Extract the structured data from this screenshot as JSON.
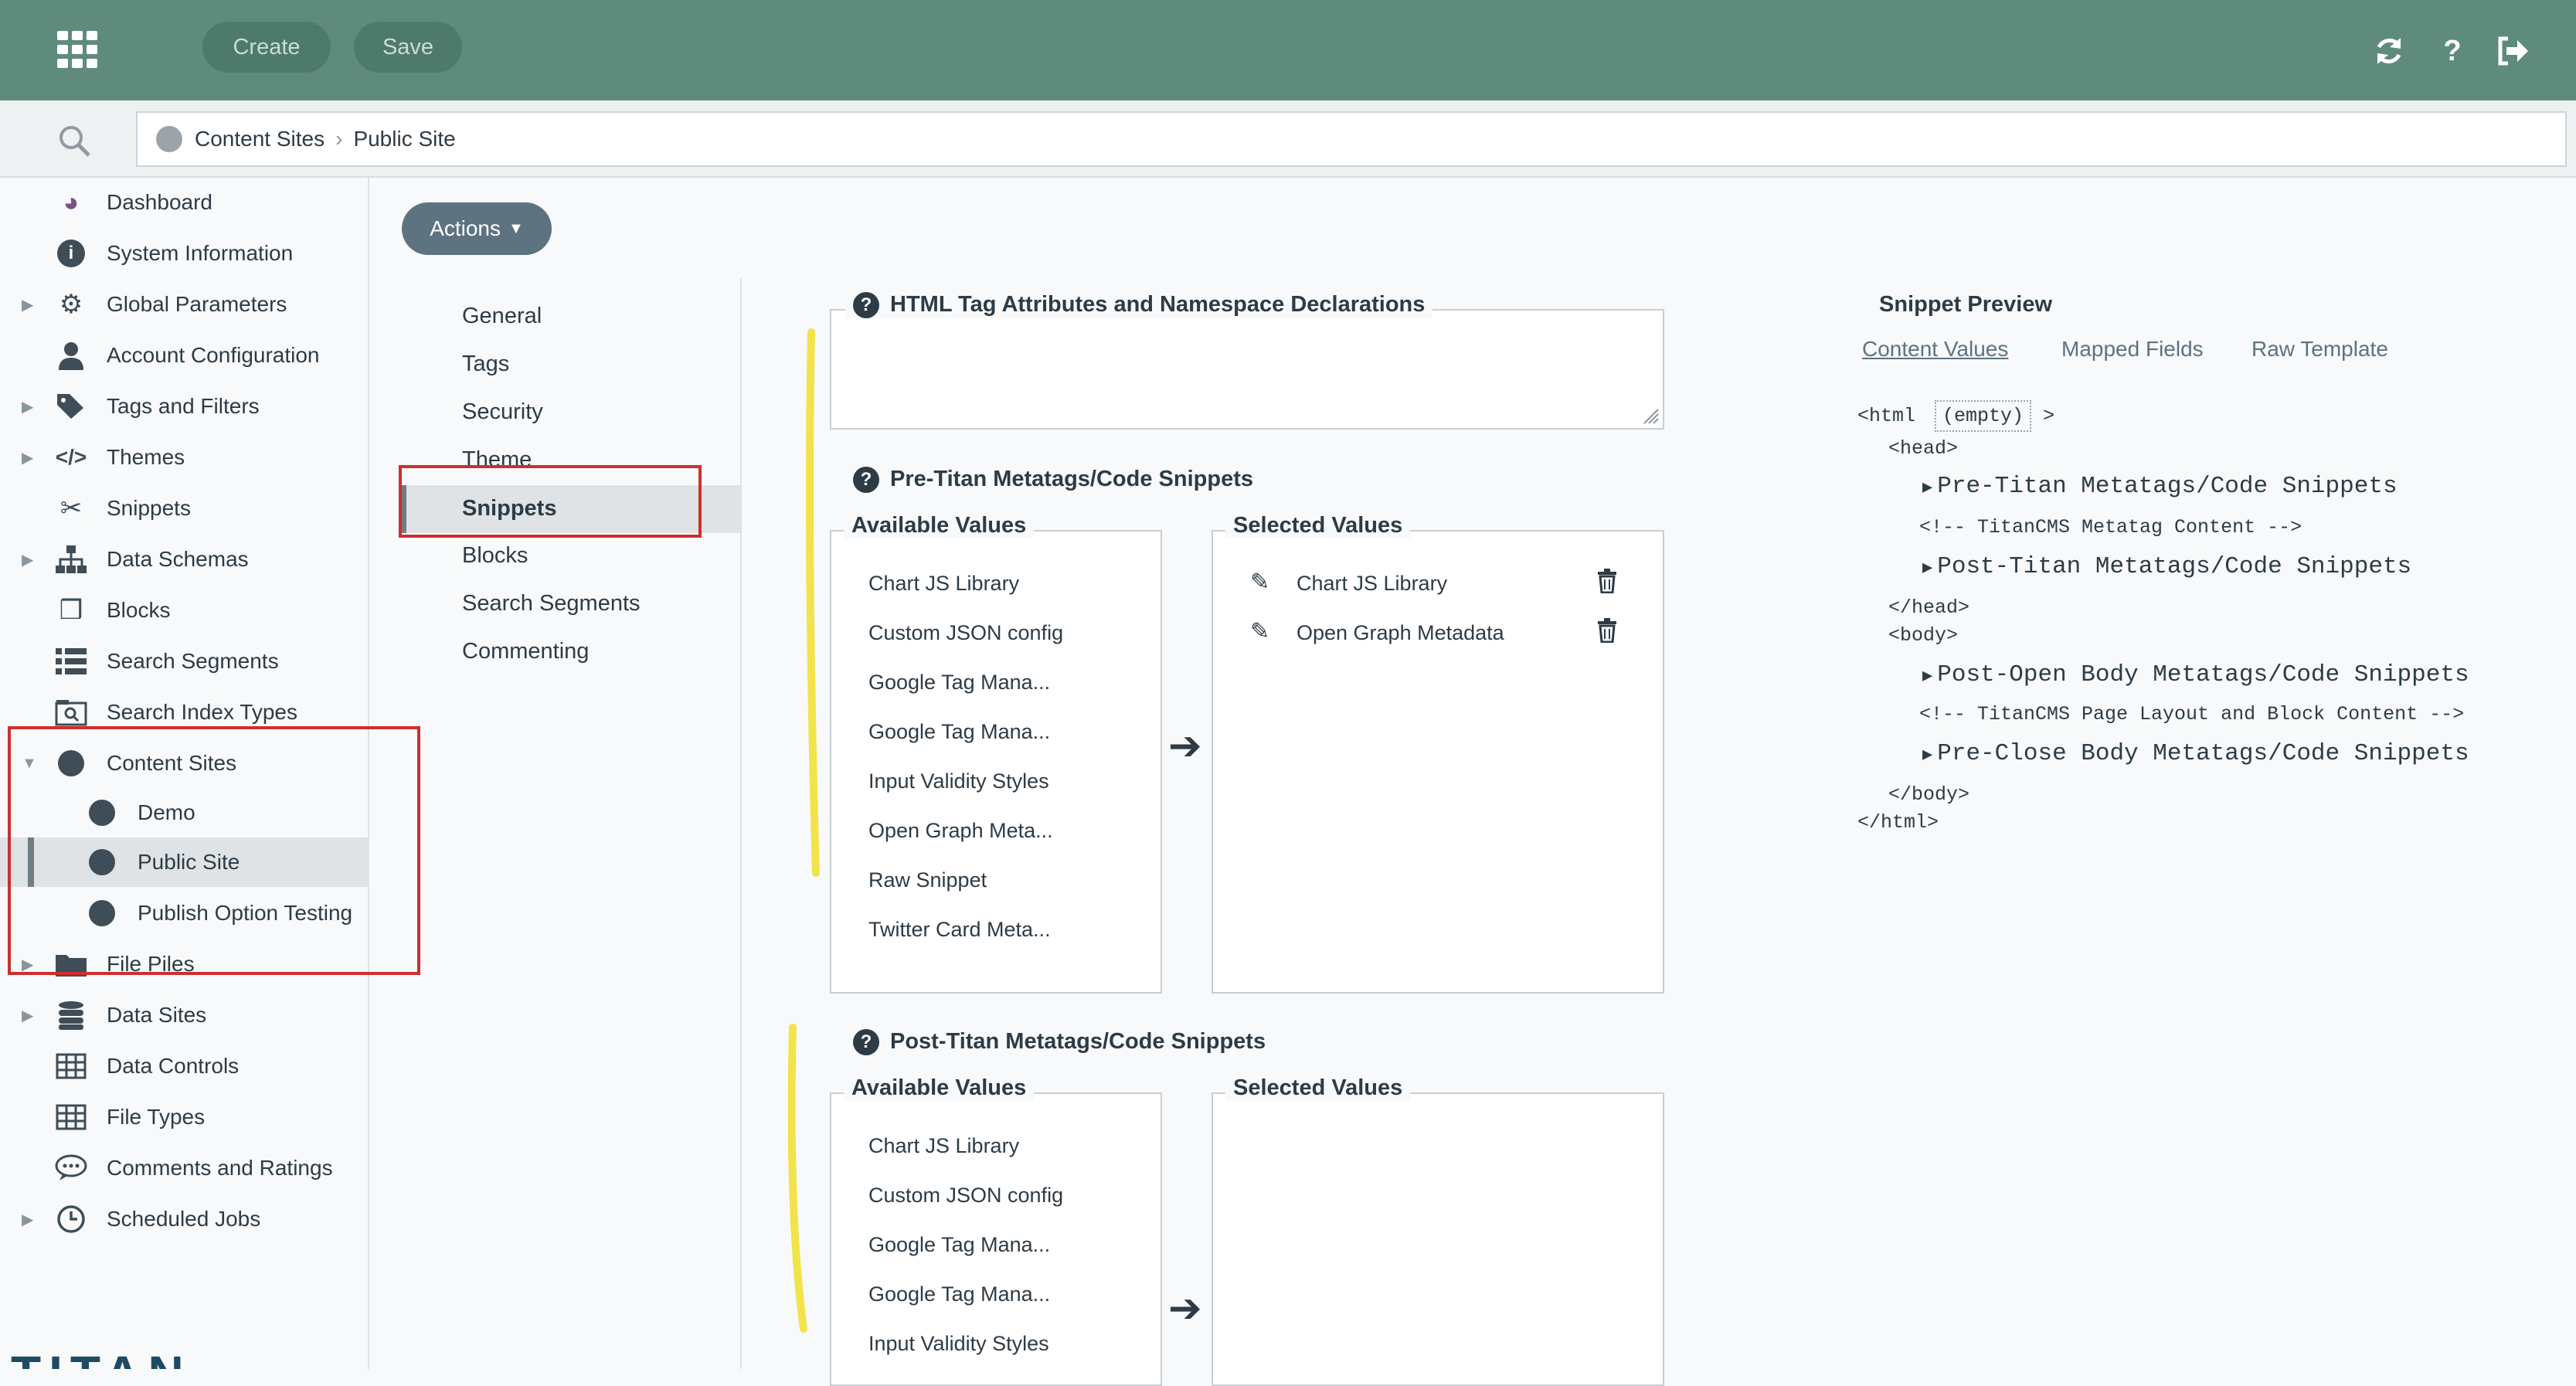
{
  "toolbar": {
    "create_label": "Create",
    "save_label": "Save",
    "apps_icon": "apps-grid-icon",
    "refresh_icon": "refresh-icon",
    "help_icon": "help-icon",
    "logout_icon": "logout-icon"
  },
  "breadcrumb": {
    "items": [
      "Content Sites",
      "Public Site"
    ]
  },
  "sidebar": {
    "items": [
      {
        "label": "Dashboard"
      },
      {
        "label": "System Information"
      },
      {
        "label": "Global Parameters"
      },
      {
        "label": "Account Configuration"
      },
      {
        "label": "Tags and Filters"
      },
      {
        "label": "Themes"
      },
      {
        "label": "Snippets"
      },
      {
        "label": "Data Schemas"
      },
      {
        "label": "Blocks"
      },
      {
        "label": "Search Segments"
      },
      {
        "label": "Search Index Types"
      },
      {
        "label": "Content Sites"
      },
      {
        "label": "Demo"
      },
      {
        "label": "Public Site"
      },
      {
        "label": "Publish Option Testing"
      },
      {
        "label": "File Piles"
      },
      {
        "label": "Data Sites"
      },
      {
        "label": "Data Controls"
      },
      {
        "label": "File Types"
      },
      {
        "label": "Comments and Ratings"
      },
      {
        "label": "Scheduled Jobs"
      }
    ],
    "logo_text": "TITAN"
  },
  "actions_label": "Actions",
  "tabs": [
    "General",
    "Tags",
    "Security",
    "Theme",
    "Snippets",
    "Blocks",
    "Search Segments",
    "Commenting"
  ],
  "html_attrs": {
    "title": "HTML Tag Attributes and Namespace Declarations",
    "value": ""
  },
  "pre_titan": {
    "title": "Pre-Titan Metatags/Code Snippets",
    "available_title": "Available Values",
    "selected_title": "Selected Values",
    "available": [
      "Chart JS Library",
      "Custom JSON config",
      "Google Tag Mana...",
      "Google Tag Mana...",
      "Input Validity Styles",
      "Open Graph Meta...",
      "Raw Snippet",
      "Twitter Card Meta..."
    ],
    "selected": [
      "Chart JS Library",
      "Open Graph Metadata"
    ]
  },
  "post_titan": {
    "title": "Post-Titan Metatags/Code Snippets",
    "available_title": "Available Values",
    "selected_title": "Selected Values",
    "available": [
      "Chart JS Library",
      "Custom JSON config",
      "Google Tag Mana...",
      "Google Tag Mana...",
      "Input Validity Styles"
    ]
  },
  "preview": {
    "title": "Snippet Preview",
    "tabs": [
      "Content Values",
      "Mapped Fields",
      "Raw Template"
    ],
    "html_open": "<html",
    "empty": "(empty)",
    "gt": ">",
    "head_open": "<head>",
    "pre_titan": "Pre-Titan Metatags/Code Snippets",
    "metatag_comment": "<!-- TitanCMS Metatag Content -->",
    "post_titan": "Post-Titan Metatags/Code Snippets",
    "head_close": "</head>",
    "body_open": "<body>",
    "post_open_body": "Post-Open Body Metatags/Code Snippets",
    "layout_comment": "<!-- TitanCMS Page Layout and Block Content -->",
    "pre_close_body": "Pre-Close Body Metatags/Code Snippets",
    "body_close": "</body>",
    "html_close": "</html>",
    "triangle": "▶"
  },
  "colors": {
    "topbar": "#5f8b7c",
    "highlight_box": "#cc2f2f",
    "annotation_yellow": "#f2e34a"
  }
}
